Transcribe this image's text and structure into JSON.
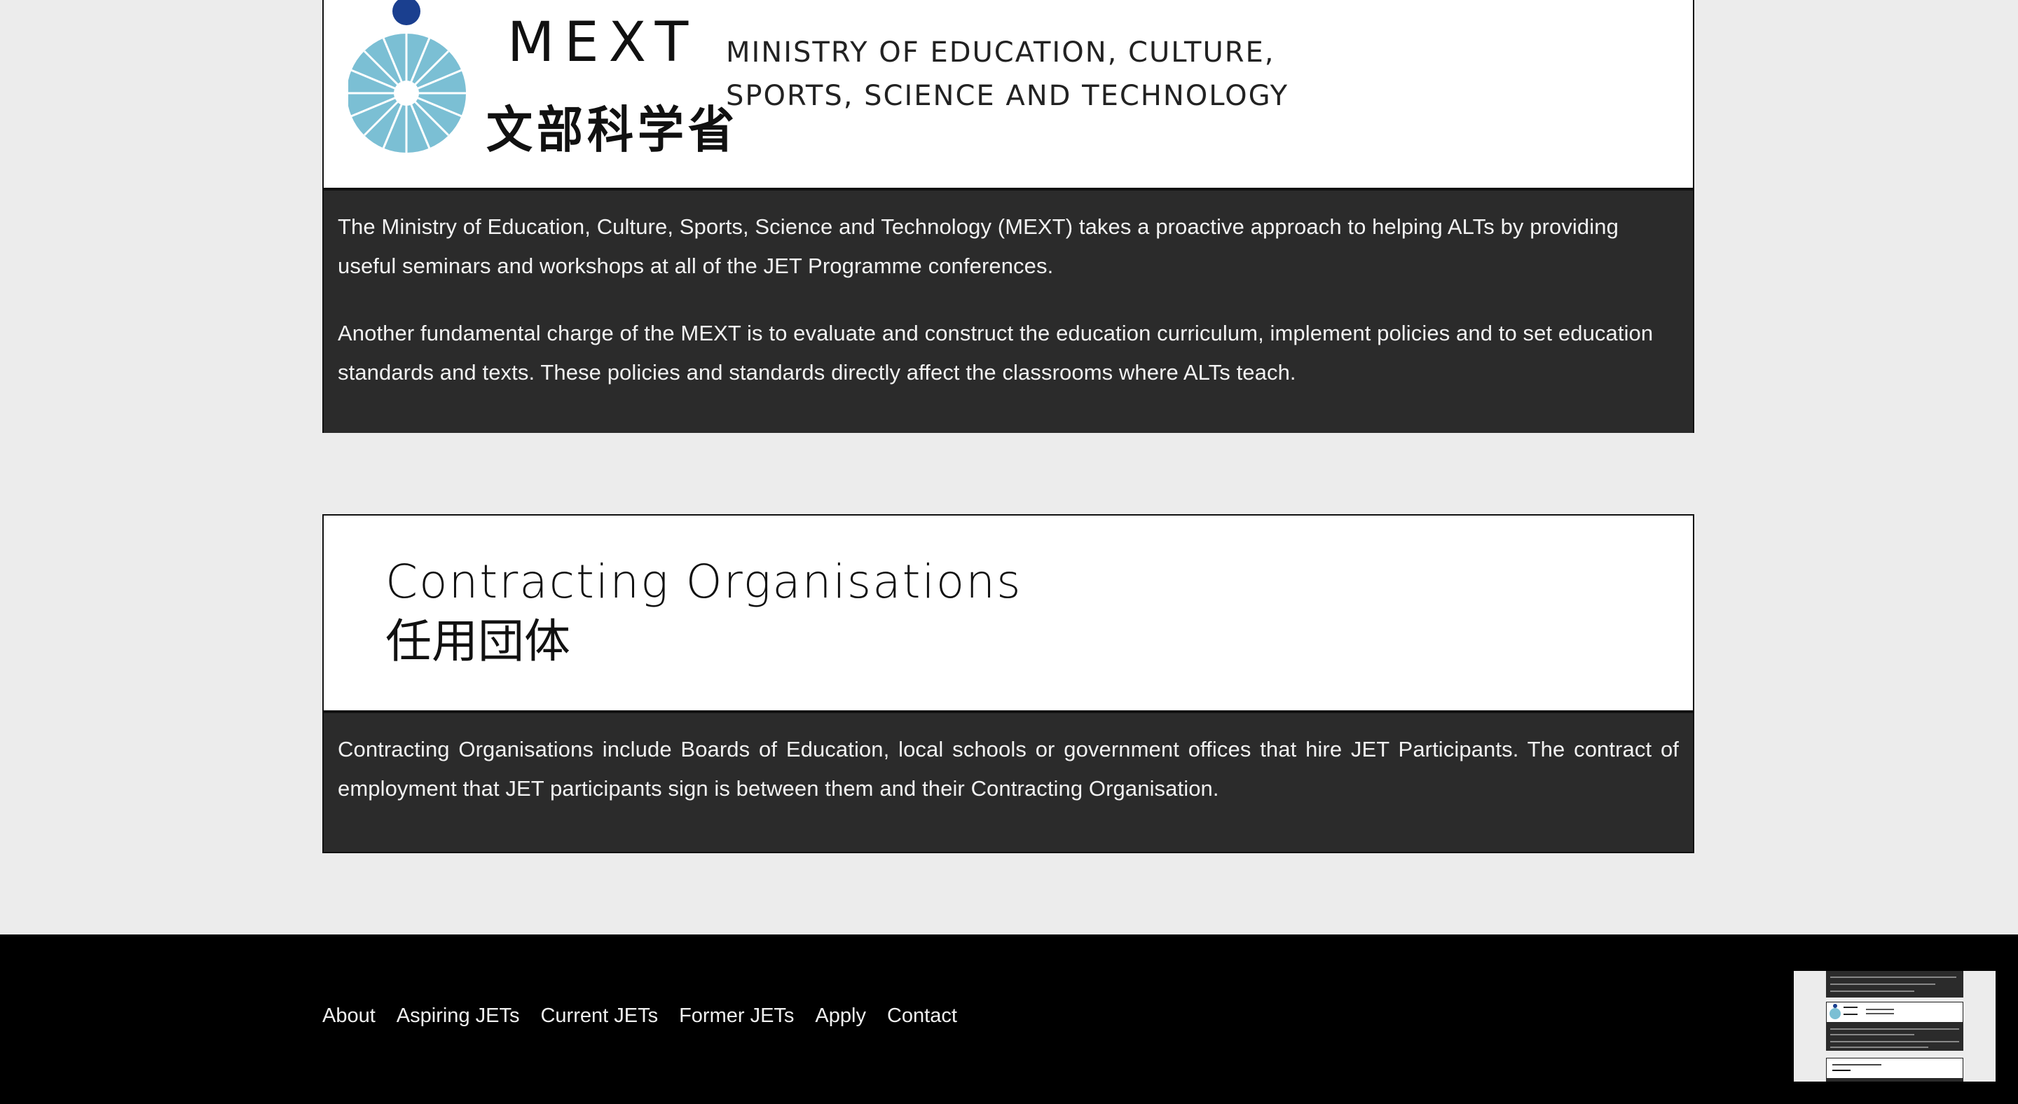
{
  "mext": {
    "logo": {
      "wordmark": "MEXT",
      "kanji": "文部科学省",
      "ministry_line1": "MINISTRY OF EDUCATION, CULTURE,",
      "ministry_line2": "SPORTS, SCIENCE AND TECHNOLOGY"
    },
    "paragraph1": "The Ministry of Education, Culture, Sports, Science and Technology (MEXT) takes a proactive approach to helping ALTs by providing useful seminars and workshops at all of the JET Programme conferences.",
    "paragraph2": "Another fundamental charge of the MEXT is to evaluate and construct the education curriculum, implement policies and to set education standards and texts. These policies and standards directly affect the classrooms where ALTs teach."
  },
  "contracting": {
    "title_en": "Contracting Organisations",
    "title_jp": "任用団体",
    "paragraph": "Contracting Organisations include Boards of Education, local schools or government offices that hire JET Participants. The contract of employment that JET participants sign is between them and their Contracting Organisation."
  },
  "footer": {
    "nav": [
      "About",
      "Aspiring JETs",
      "Current JETs",
      "Former JETs",
      "Apply",
      "Contact"
    ]
  },
  "colors": {
    "page_bg": "#ececec",
    "panel_dark": "#2b2b2b",
    "footer_bg": "#000000",
    "logo_blue": "#7bbfd4",
    "logo_dot": "#1a3f8f"
  }
}
